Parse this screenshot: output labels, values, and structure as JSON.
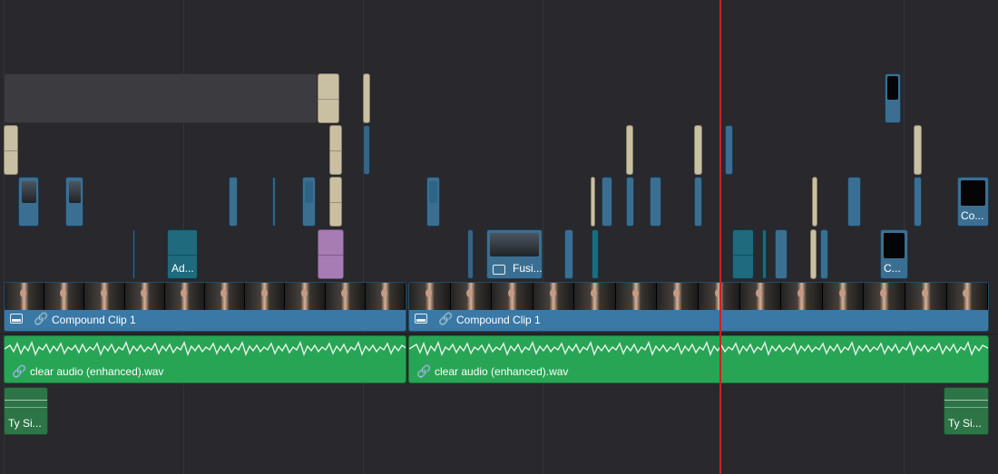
{
  "colors": {
    "playhead": "#d11f22",
    "video_clip": "#3a78a6",
    "audio_clip": "#28a455",
    "adjustment_clip": "#1f6a7d",
    "title_clip": "#c9bfa3",
    "fusion_purple": "#a77bb4"
  },
  "icons": [
    "film-icon",
    "link-icon"
  ],
  "clips": {
    "adjustment_label": "Ad...",
    "fusion_label": "Fusi...",
    "compound_short_label": "Co...",
    "compound_tiny_label": "C...",
    "video_v1_a_label": "Compound Clip 1",
    "video_v1_b_label": "Compound Clip 1",
    "audio_a1_a_label": "clear audio (enhanced).wav",
    "audio_a1_b_label": "clear audio (enhanced).wav",
    "audio_a2_left_label": "Ty Si...",
    "audio_a2_right_label": "Ty Si..."
  }
}
